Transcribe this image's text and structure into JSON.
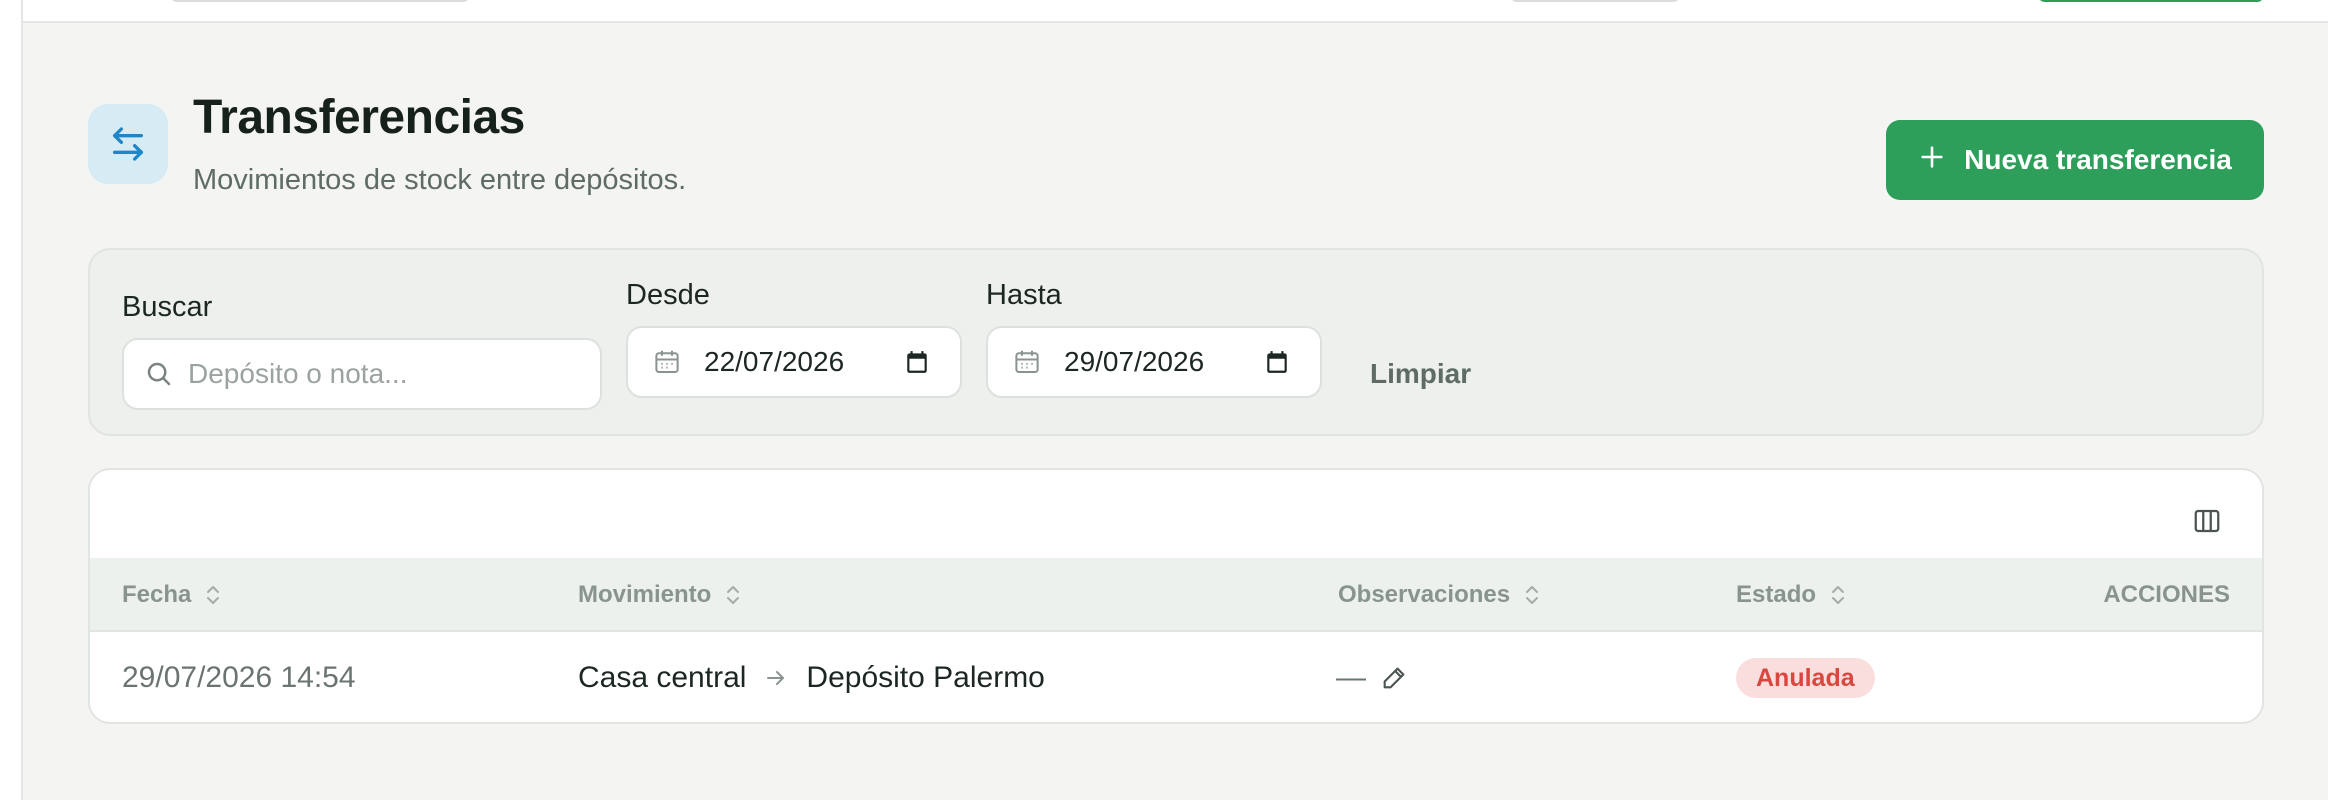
{
  "header": {
    "title": "Transferencias",
    "subtitle": "Movimientos de stock entre depósitos.",
    "icon": "arrows-left-right-icon",
    "new_button_label": "Nueva transferencia"
  },
  "filters": {
    "search_label": "Buscar",
    "search_placeholder": "Depósito o nota...",
    "search_value": "",
    "from_label": "Desde",
    "from_value": "22/07/2026",
    "to_label": "Hasta",
    "to_value": "29/07/2026",
    "clear_label": "Limpiar"
  },
  "table": {
    "columns": [
      "Fecha",
      "Movimiento",
      "Observaciones",
      "Estado",
      "ACCIONES"
    ],
    "rows": [
      {
        "fecha": "29/07/2026 14:54",
        "origen": "Casa central",
        "destino": "Depósito Palermo",
        "observaciones": "—",
        "estado": "Anulada"
      }
    ]
  },
  "colors": {
    "accent_green": "#2e9e5b",
    "icon_blue": "#1f86c7",
    "status_cancelled_bg": "#fadede",
    "status_cancelled_text": "#d9473f"
  }
}
